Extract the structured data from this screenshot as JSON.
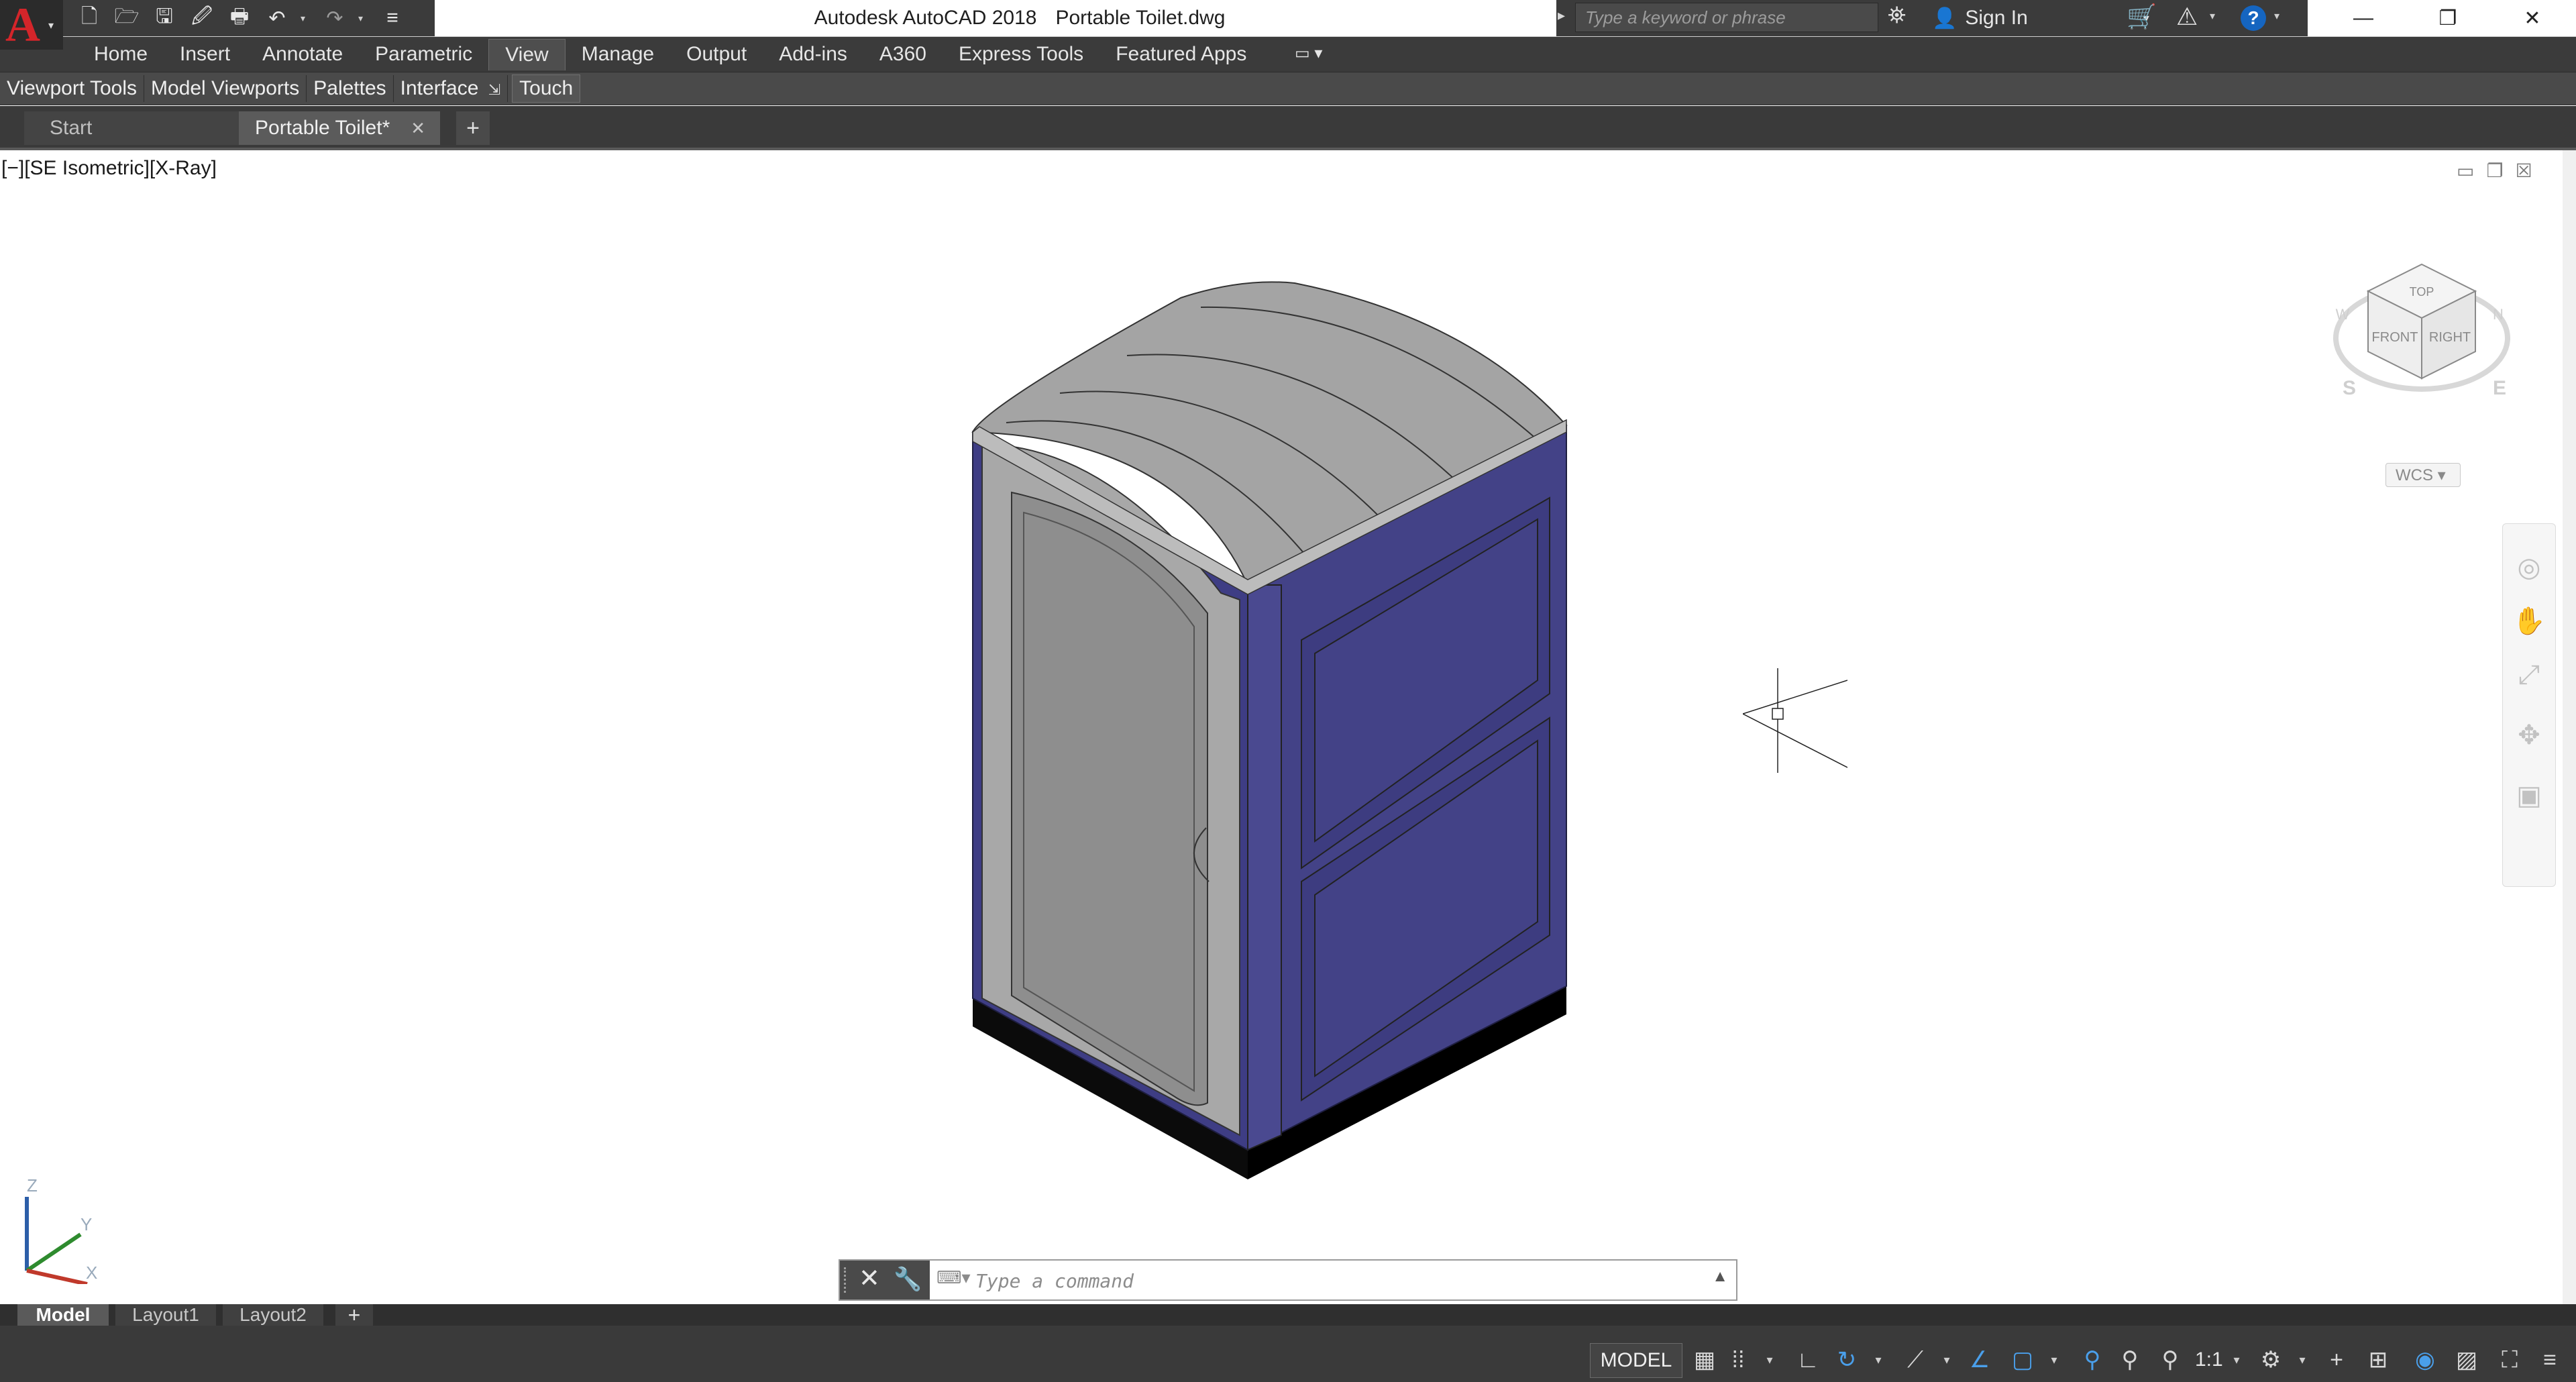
{
  "app": {
    "name": "Autodesk AutoCAD 2018",
    "document": "Portable Toilet.dwg",
    "logo_letter": "A"
  },
  "search": {
    "placeholder": "Type a keyword or phrase"
  },
  "account": {
    "signin_label": "Sign In"
  },
  "help_glyph": "?",
  "ribbon": {
    "tabs": [
      "Home",
      "Insert",
      "Annotate",
      "Parametric",
      "View",
      "Manage",
      "Output",
      "Add-ins",
      "A360",
      "Express Tools",
      "Featured Apps"
    ],
    "active_tab": "View",
    "panels": [
      "Viewport Tools",
      "Model Viewports",
      "Palettes",
      "Interface",
      "Touch"
    ]
  },
  "file_tabs": {
    "start_label": "Start",
    "active_label": "Portable Toilet*"
  },
  "viewport": {
    "label": "[−][SE Isometric][X-Ray]",
    "viewcube": {
      "top": "TOP",
      "front": "FRONT",
      "right": "RIGHT",
      "compass_s": "S",
      "compass_e": "E",
      "compass_w": "W",
      "compass_n": "N"
    },
    "wcs_label": "WCS",
    "ucs": {
      "z": "Z",
      "y": "Y",
      "x": "X"
    }
  },
  "command_line": {
    "placeholder": "Type a command"
  },
  "layout_tabs": [
    "Model",
    "Layout1",
    "Layout2"
  ],
  "status_bar": {
    "mode_label": "MODEL",
    "annotation_scale": "1:1"
  },
  "colors": {
    "toilet_body": "#434287",
    "toilet_roof": "#a4a4a4",
    "toilet_door": "#8e8e8e",
    "accent_blue": "#1565c0",
    "logo_red": "#d4252a"
  }
}
